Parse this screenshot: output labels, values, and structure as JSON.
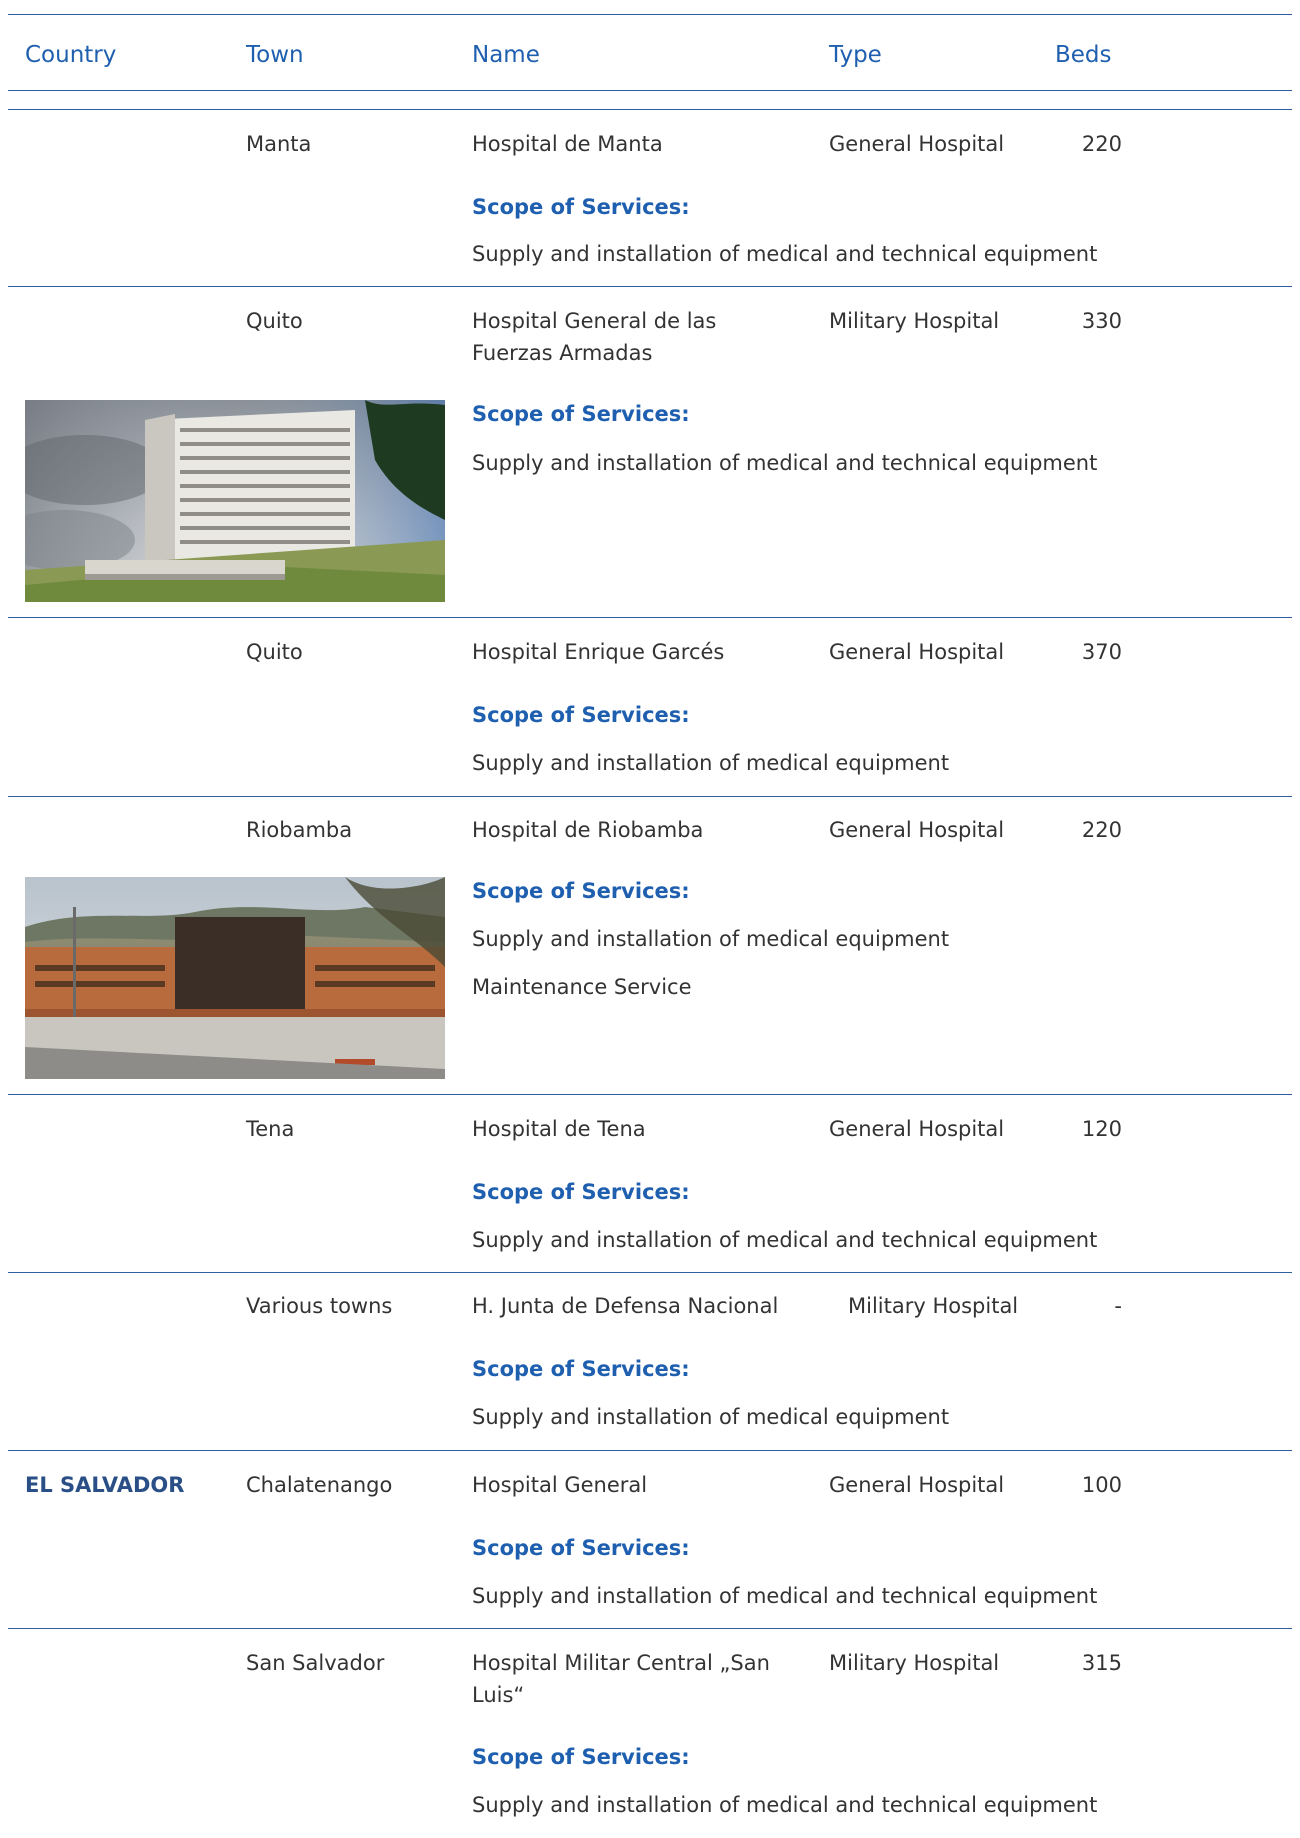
{
  "header": {
    "country": "Country",
    "town": "Town",
    "name": "Name",
    "type": "Type",
    "beds": "Beds"
  },
  "scope_label": "Scope of Services:",
  "rows": [
    {
      "country": "",
      "town": "Manta",
      "name": "Hospital de Manta",
      "type": "General Hospital",
      "beds": "220",
      "services": [
        "Supply and installation of  medical and technical equipment"
      ]
    },
    {
      "country": "",
      "town": "Quito",
      "name": "Hospital General de las Fuerzas Armadas",
      "type": "Military Hospital",
      "beds": "330",
      "services": [
        "Supply and installation of  medical and technical equipment"
      ]
    },
    {
      "country": "",
      "town": "Quito",
      "name": "Hospital Enrique Garcés",
      "type": "General Hospital",
      "beds": "370",
      "services": [
        "Supply and installation of medical equipment"
      ]
    },
    {
      "country": "",
      "town": "Riobamba",
      "name": "Hospital de Riobamba",
      "type": "General Hospital",
      "beds": "220",
      "services": [
        "Supply and installation of medical equipment",
        "Maintenance Service"
      ]
    },
    {
      "country": "",
      "town": "Tena",
      "name": "Hospital de Tena",
      "type": "General Hospital",
      "beds": "120",
      "services": [
        "Supply and installation of  medical and technical equipment"
      ]
    },
    {
      "country": "",
      "town": "Various towns",
      "name": "H. Junta de Defensa Nacional",
      "type": "Military Hospital",
      "beds": "-",
      "services": [
        "Supply and installation of medical equipment"
      ]
    },
    {
      "country": "EL SALVADOR",
      "town": "Chalatenango",
      "name": "Hospital General",
      "type": "General Hospital",
      "beds": "100",
      "services": [
        "Supply and installation of medical and technical equipment"
      ]
    },
    {
      "country": "",
      "town": "San Salvador",
      "name": "Hospital Militar Central „San Luis“",
      "type": "Military Hospital",
      "beds": "315",
      "services": [
        "Supply and installation of medical and technical equipment"
      ]
    }
  ],
  "colors": {
    "accent": "#1f5faf",
    "rule": "#2f5f9e",
    "text": "#333333"
  }
}
